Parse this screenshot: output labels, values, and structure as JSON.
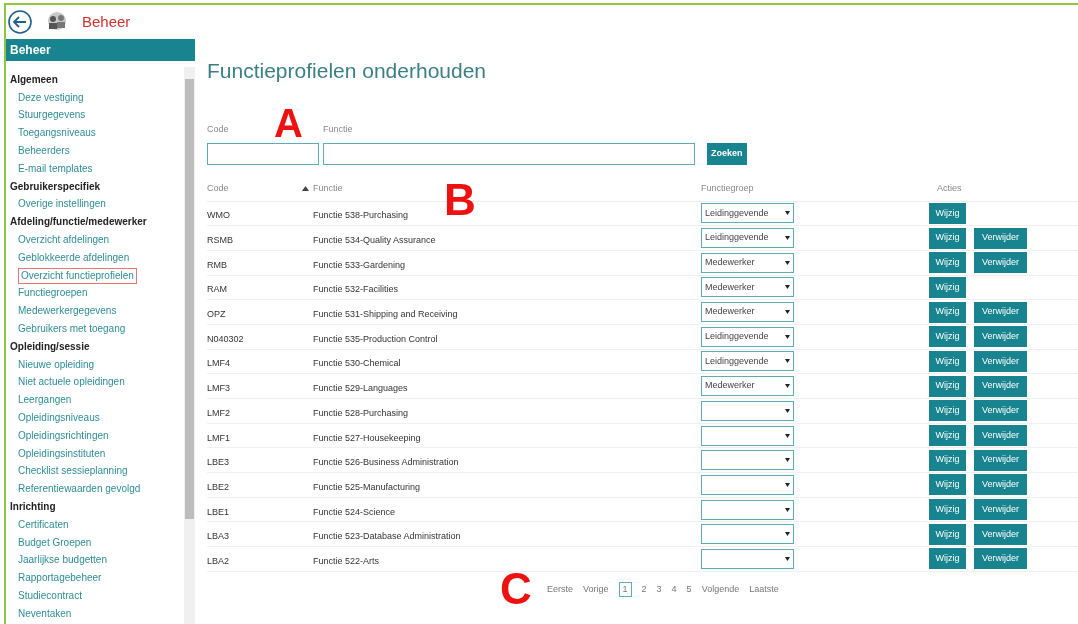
{
  "top_bar": {
    "title": "Beheer"
  },
  "sidebar": {
    "header": "Beheer",
    "sections": [
      {
        "title": "Algemeen",
        "items": [
          {
            "label": "Deze vestiging",
            "selected": false
          },
          {
            "label": "Stuurgegevens",
            "selected": false
          },
          {
            "label": "Toegangsniveaus",
            "selected": false
          },
          {
            "label": "Beheerders",
            "selected": false
          },
          {
            "label": "E-mail templates",
            "selected": false
          }
        ]
      },
      {
        "title": "Gebruikerspecifiek",
        "items": [
          {
            "label": "Overige instellingen",
            "selected": false
          }
        ]
      },
      {
        "title": "Afdeling/functie/medewerker",
        "items": [
          {
            "label": "Overzicht afdelingen",
            "selected": false
          },
          {
            "label": "Geblokkeerde afdelingen",
            "selected": false
          },
          {
            "label": "Overzicht functieprofielen",
            "selected": true
          },
          {
            "label": "Functiegroepen",
            "selected": false
          },
          {
            "label": "Medewerkergegevens",
            "selected": false
          },
          {
            "label": "Gebruikers met toegang",
            "selected": false
          }
        ]
      },
      {
        "title": "Opleiding/sessie",
        "items": [
          {
            "label": "Nieuwe opleiding",
            "selected": false
          },
          {
            "label": "Niet actuele opleidingen",
            "selected": false
          },
          {
            "label": "Leergangen",
            "selected": false
          },
          {
            "label": "Opleidingsniveaus",
            "selected": false
          },
          {
            "label": "Opleidingsrichtingen",
            "selected": false
          },
          {
            "label": "Opleidingsinstituten",
            "selected": false
          },
          {
            "label": "Checklist sessieplanning",
            "selected": false
          },
          {
            "label": "Referentiewaarden gevolgd",
            "selected": false
          }
        ]
      },
      {
        "title": "Inrichting",
        "items": [
          {
            "label": "Certificaten",
            "selected": false
          },
          {
            "label": "Budget Groepen",
            "selected": false
          },
          {
            "label": "Jaarlijkse budgetten",
            "selected": false
          },
          {
            "label": "Rapportagebeheer",
            "selected": false
          },
          {
            "label": "Studiecontract",
            "selected": false
          },
          {
            "label": "Neventaken",
            "selected": false
          }
        ]
      }
    ]
  },
  "page_title": "Functieprofielen onderhouden",
  "search": {
    "fields": [
      {
        "label": "Code"
      },
      {
        "label": "Functie"
      }
    ],
    "button": "Zoeken"
  },
  "table": {
    "columns": [
      {
        "label": "Code",
        "sorted": false
      },
      {
        "label": "Functie",
        "sorted": true
      },
      {
        "label": "Functiegroep",
        "sorted": false
      },
      {
        "label": "Acties",
        "sorted": false
      }
    ],
    "rows": [
      {
        "code": "WMO",
        "functie": "Functie 538-Purchasing",
        "functiegroep": "Leidinggevende",
        "actions": [
          "Wijzig"
        ]
      },
      {
        "code": "RSMB",
        "functie": "Functie 534-Quality Assurance",
        "functiegroep": "Leidinggevende",
        "actions": [
          "Wijzig",
          "Verwijder"
        ]
      },
      {
        "code": "RMB",
        "functie": "Functie 533-Gardening",
        "functiegroep": "Medewerker",
        "actions": [
          "Wijzig",
          "Verwijder"
        ]
      },
      {
        "code": "RAM",
        "functie": "Functie 532-Facilities",
        "functiegroep": "Medewerker",
        "actions": [
          "Wijzig"
        ]
      },
      {
        "code": "OPZ",
        "functie": "Functie 531-Shipping and Receiving",
        "functiegroep": "Medewerker",
        "actions": [
          "Wijzig",
          "Verwijder"
        ]
      },
      {
        "code": "N040302",
        "functie": "Functie 535-Production Control",
        "functiegroep": "Leidinggevende",
        "actions": [
          "Wijzig",
          "Verwijder"
        ]
      },
      {
        "code": "LMF4",
        "functie": "Functie 530-Chemical",
        "functiegroep": "Leidinggevende",
        "actions": [
          "Wijzig",
          "Verwijder"
        ]
      },
      {
        "code": "LMF3",
        "functie": "Functie 529-Languages",
        "functiegroep": "Medewerker",
        "actions": [
          "Wijzig",
          "Verwijder"
        ]
      },
      {
        "code": "LMF2",
        "functie": "Functie 528-Purchasing",
        "actions": [
          "Wijzig",
          "Verwijder"
        ]
      },
      {
        "code": "LMF1",
        "functie": "Functie 527-Housekeeping",
        "actions": [
          "Wijzig",
          "Verwijder"
        ]
      },
      {
        "code": "LBE3",
        "functie": "Functie 526-Business Administration",
        "actions": [
          "Wijzig",
          "Verwijder"
        ]
      },
      {
        "code": "LBE2",
        "functie": "Functie 525-Manufacturing",
        "actions": [
          "Wijzig",
          "Verwijder"
        ]
      },
      {
        "code": "LBE1",
        "functie": "Functie 524-Science",
        "actions": [
          "Wijzig",
          "Verwijder"
        ]
      },
      {
        "code": "LBA3",
        "functie": "Functie 523-Database Administration",
        "actions": [
          "Wijzig",
          "Verwijder"
        ]
      },
      {
        "code": "LBA2",
        "functie": "Functie 522-Arts",
        "actions": [
          "Wijzig",
          "Verwijder"
        ]
      }
    ]
  },
  "pagination": {
    "first": "Eerste",
    "previous": "Vorige",
    "pages": [
      {
        "label": "1",
        "selected": true
      },
      {
        "label": "2",
        "selected": false
      },
      {
        "label": "3",
        "selected": false
      },
      {
        "label": "4",
        "selected": false
      },
      {
        "label": "5",
        "selected": false
      }
    ],
    "next": "Volgende",
    "last": "Laatste"
  },
  "annotations": [
    "A",
    "B",
    "C"
  ]
}
